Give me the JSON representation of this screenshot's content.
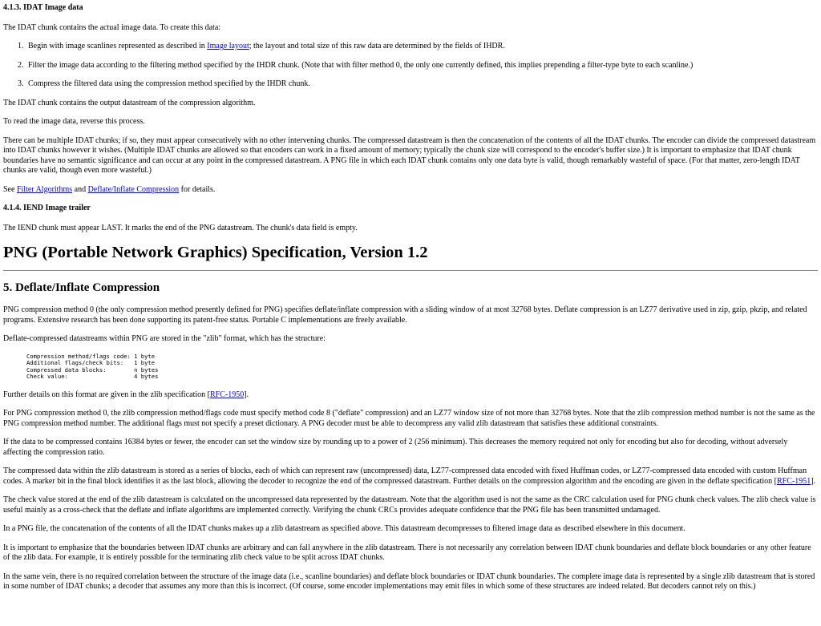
{
  "sec413": {
    "heading": "4.1.3. IDAT Image data",
    "intro": "The IDAT chunk contains the actual image data. To create this data:",
    "steps": {
      "s1_before": "Begin with image scanlines represented as described in ",
      "s1_link": "Image layout",
      "s1_after": "; the layout and total size of this raw data are determined by the fields of IHDR.",
      "s2": "Filter the image data according to the filtering method specified by the IHDR chunk. (Note that with filter method 0, the only one currently defined, this implies prepending a filter-type byte to each scanline.)",
      "s3": "Compress the filtered data using the compression method specified by the IHDR chunk."
    },
    "p_output": "The IDAT chunk contains the output datastream of the compression algorithm.",
    "p_reverse": "To read the image data, reverse this process.",
    "p_multiple": "There can be multiple IDAT chunks; if so, they must appear consecutively with no other intervening chunks. The compressed datastream is then the concatenation of the contents of all the IDAT chunks. The encoder can divide the compressed datastream into IDAT chunks however it wishes. (Multiple IDAT chunks are allowed so that encoders can work in a fixed amount of memory; typically the chunk size will correspond to the encoder's buffer size.) It is important to emphasize that IDAT chunk boundaries have no semantic significance and can occur at any point in the compressed datastream. A PNG file in which each IDAT chunk contains only one data byte is valid, though remarkably wasteful of space. (For that matter, zero-length IDAT chunks are valid, though even more wasteful.)",
    "see_prefix": "See ",
    "see_link1": "Filter Algorithms",
    "see_and": " and ",
    "see_link2": "Deflate/Inflate Compression",
    "see_suffix": " for details."
  },
  "sec414": {
    "heading": "4.1.4. IEND Image trailer",
    "body": "The IEND chunk must appear LAST. It marks the end of the PNG datastream. The chunk's data field is empty."
  },
  "doc_title": "PNG (Portable Network Graphics) Specification, Version 1.2",
  "sec5": {
    "heading": "5. Deflate/Inflate Compression",
    "p1": "PNG compression method 0 (the only compression method presently defined for PNG) specifies deflate/inflate compression with a sliding window of at most 32768 bytes. Deflate compression is an LZ77 derivative used in zip, gzip, pkzip, and related programs. Extensive research has been done supporting its patent-free status. Portable C implementations are freely available.",
    "p2": "Deflate-compressed datastreams within PNG are stored in the \"zlib\" format, which has the structure:",
    "code": "   Compression method/flags code: 1 byte\n   Additional flags/check bits:   1 byte\n   Compressed data blocks:        n bytes\n   Check value:                   4 bytes",
    "p3_prefix": "Further details on this format are given in the zlib specification [",
    "p3_link": "RFC-1950",
    "p3_suffix": "].",
    "p4": "For PNG compression method 0, the zlib compression method/flags code must specify method code 8 (\"deflate\" compression) and an LZ77 window size of not more than 32768 bytes. Note that the zlib compression method number is not the same as the PNG compression method number. The additional flags must not specify a preset dictionary. A PNG decoder must be able to decompress any valid zlib datastream that satisfies these additional constraints.",
    "p5": "If the data to be compressed contains 16384 bytes or fewer, the encoder can set the window size by rounding up to a power of 2 (256 minimum). This decreases the memory required not only for encoding but also for decoding, without adversely affecting the compression ratio.",
    "p6_prefix": "The compressed data within the zlib datastream is stored as a series of blocks, each of which can represent raw (uncompressed) data, LZ77-compressed data encoded with fixed Huffman codes, or LZ77-compressed data encoded with custom Huffman codes. A marker bit in the final block identifies it as the last block, allowing the decoder to recognize the end of the compressed datastream. Further details on the compression algorithm and the encoding are given in the deflate specification [",
    "p6_link": "RFC-1951",
    "p6_suffix": "].",
    "p7": "The check value stored at the end of the zlib datastream is calculated on the uncompressed data represented by the datastream. Note that the algorithm used is not the same as the CRC calculation used for PNG chunk check values. The zlib check value is useful mainly as a cross-check that the deflate and inflate algorithms are implemented correctly. Verifying the chunk CRCs provides adequate confidence that the PNG file has been transmitted undamaged.",
    "p8": "In a PNG file, the concatenation of the contents of all the IDAT chunks makes up a zlib datastream as specified above. This datastream decompresses to filtered image data as described elsewhere in this document.",
    "p9": "It is important to emphasize that the boundaries between IDAT chunks are arbitrary and can fall anywhere in the zlib datastream. There is not necessarily any correlation between IDAT chunk boundaries and deflate block boundaries or any other feature of the zlib data. For example, it is entirely possible for the terminating zlib check value to be split across IDAT chunks.",
    "p10": "In the same vein, there is no required correlation between the structure of the image data (i.e., scanline boundaries) and deflate block boundaries or IDAT chunk boundaries. The complete image data is represented by a single zlib datastream that is stored in some number of IDAT chunks; a decoder that assumes any more than this is incorrect. (Of course, some encoder implementations may emit files in which some of these structures are indeed related. But decoders cannot rely on this.)"
  }
}
